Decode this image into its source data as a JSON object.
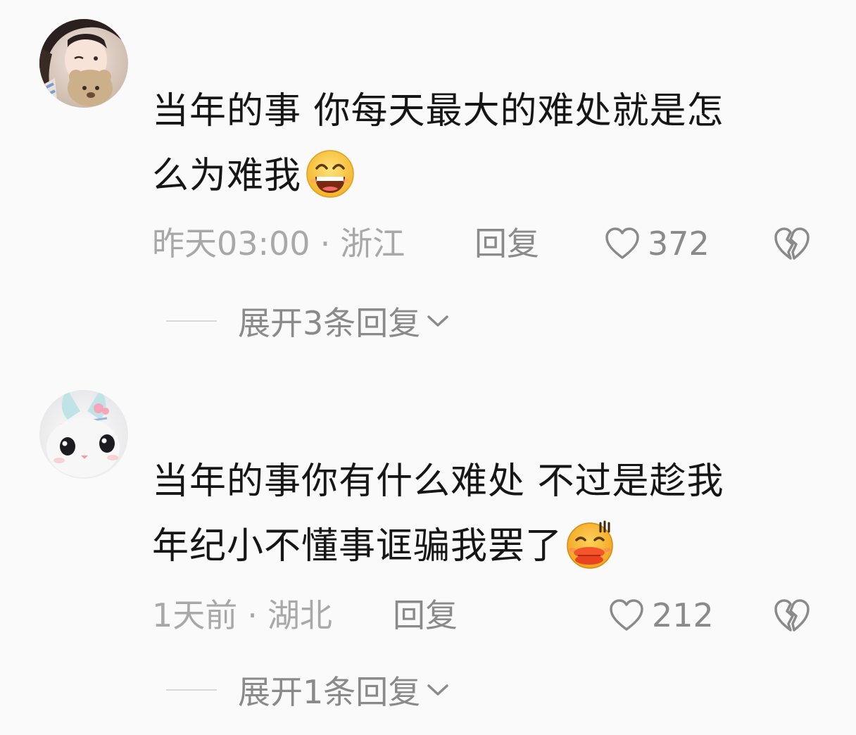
{
  "comments": [
    {
      "text_line1": "当年的事 你每天最大的难处就是怎",
      "text_line2": "么为难我",
      "emoji": "grinning-face-emoji",
      "time": "昨天03:00",
      "dot": "·",
      "location": "浙江",
      "reply": "回复",
      "likes": "372",
      "expand": "展开3条回复"
    },
    {
      "text_line1": "当年的事你有什么难处 不过是趁我",
      "text_line2": "年纪小不懂事诓骗我罢了",
      "emoji": "pouting-lips-emoji",
      "time": "1天前",
      "dot": "·",
      "location": "湖北",
      "reply": "回复",
      "likes": "212",
      "expand": "展开1条回复"
    }
  ],
  "colors": {
    "background": "#fafafa",
    "text": "#161616",
    "meta": "#a8a8a8",
    "action": "#8a8a8a"
  },
  "icons": [
    "heart-icon",
    "broken-heart-icon",
    "chevron-down-icon"
  ]
}
